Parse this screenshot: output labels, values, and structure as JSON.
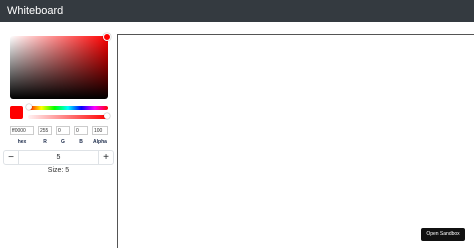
{
  "app": {
    "title": "Whiteboard"
  },
  "picker": {
    "color": "#ff0000",
    "hue_degrees": 0,
    "alpha_percent": 100,
    "fields": [
      {
        "value": "ff0000",
        "label": "hex"
      },
      {
        "value": "255",
        "label": "R"
      },
      {
        "value": "0",
        "label": "G"
      },
      {
        "value": "0",
        "label": "B"
      },
      {
        "value": "100",
        "label": "Alpha"
      }
    ]
  },
  "brush": {
    "minus_label": "−",
    "plus_label": "+",
    "value": "5",
    "size_label": "Size: 5"
  },
  "canvas": {
    "sandbox_label": "Open Sandbox"
  },
  "colors": {
    "topbar": "#343a40",
    "selected": "#ff0000",
    "sandbox_button": "#111111"
  }
}
